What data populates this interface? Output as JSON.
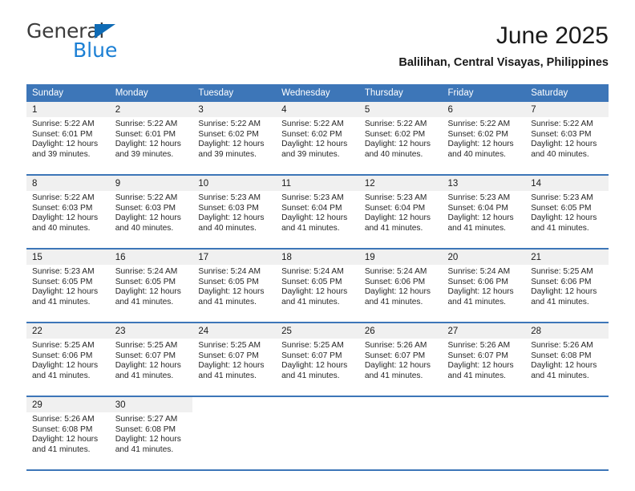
{
  "brand": {
    "name_dark": "General",
    "name_blue": "Blue",
    "triangle_color": "#0f6bb5",
    "blue_color": "#1b7fd4"
  },
  "header": {
    "title": "June 2025",
    "subtitle": "Balilihan, Central Visayas, Philippines"
  },
  "theme": {
    "header_blue": "#3d76b8",
    "daynum_band": "#f0f0f0",
    "text": "#1a1a1a"
  },
  "weekdays": [
    "Sunday",
    "Monday",
    "Tuesday",
    "Wednesday",
    "Thursday",
    "Friday",
    "Saturday"
  ],
  "labels": {
    "sunrise_prefix": "Sunrise: ",
    "sunset_prefix": "Sunset: ",
    "daylight_prefix": "Daylight: "
  },
  "weeks": [
    [
      {
        "day": "1",
        "sunrise": "Sunrise: 5:22 AM",
        "sunset": "Sunset: 6:01 PM",
        "daylight": "Daylight: 12 hours and 39 minutes."
      },
      {
        "day": "2",
        "sunrise": "Sunrise: 5:22 AM",
        "sunset": "Sunset: 6:01 PM",
        "daylight": "Daylight: 12 hours and 39 minutes."
      },
      {
        "day": "3",
        "sunrise": "Sunrise: 5:22 AM",
        "sunset": "Sunset: 6:02 PM",
        "daylight": "Daylight: 12 hours and 39 minutes."
      },
      {
        "day": "4",
        "sunrise": "Sunrise: 5:22 AM",
        "sunset": "Sunset: 6:02 PM",
        "daylight": "Daylight: 12 hours and 39 minutes."
      },
      {
        "day": "5",
        "sunrise": "Sunrise: 5:22 AM",
        "sunset": "Sunset: 6:02 PM",
        "daylight": "Daylight: 12 hours and 40 minutes."
      },
      {
        "day": "6",
        "sunrise": "Sunrise: 5:22 AM",
        "sunset": "Sunset: 6:02 PM",
        "daylight": "Daylight: 12 hours and 40 minutes."
      },
      {
        "day": "7",
        "sunrise": "Sunrise: 5:22 AM",
        "sunset": "Sunset: 6:03 PM",
        "daylight": "Daylight: 12 hours and 40 minutes."
      }
    ],
    [
      {
        "day": "8",
        "sunrise": "Sunrise: 5:22 AM",
        "sunset": "Sunset: 6:03 PM",
        "daylight": "Daylight: 12 hours and 40 minutes."
      },
      {
        "day": "9",
        "sunrise": "Sunrise: 5:22 AM",
        "sunset": "Sunset: 6:03 PM",
        "daylight": "Daylight: 12 hours and 40 minutes."
      },
      {
        "day": "10",
        "sunrise": "Sunrise: 5:23 AM",
        "sunset": "Sunset: 6:03 PM",
        "daylight": "Daylight: 12 hours and 40 minutes."
      },
      {
        "day": "11",
        "sunrise": "Sunrise: 5:23 AM",
        "sunset": "Sunset: 6:04 PM",
        "daylight": "Daylight: 12 hours and 41 minutes."
      },
      {
        "day": "12",
        "sunrise": "Sunrise: 5:23 AM",
        "sunset": "Sunset: 6:04 PM",
        "daylight": "Daylight: 12 hours and 41 minutes."
      },
      {
        "day": "13",
        "sunrise": "Sunrise: 5:23 AM",
        "sunset": "Sunset: 6:04 PM",
        "daylight": "Daylight: 12 hours and 41 minutes."
      },
      {
        "day": "14",
        "sunrise": "Sunrise: 5:23 AM",
        "sunset": "Sunset: 6:05 PM",
        "daylight": "Daylight: 12 hours and 41 minutes."
      }
    ],
    [
      {
        "day": "15",
        "sunrise": "Sunrise: 5:23 AM",
        "sunset": "Sunset: 6:05 PM",
        "daylight": "Daylight: 12 hours and 41 minutes."
      },
      {
        "day": "16",
        "sunrise": "Sunrise: 5:24 AM",
        "sunset": "Sunset: 6:05 PM",
        "daylight": "Daylight: 12 hours and 41 minutes."
      },
      {
        "day": "17",
        "sunrise": "Sunrise: 5:24 AM",
        "sunset": "Sunset: 6:05 PM",
        "daylight": "Daylight: 12 hours and 41 minutes."
      },
      {
        "day": "18",
        "sunrise": "Sunrise: 5:24 AM",
        "sunset": "Sunset: 6:05 PM",
        "daylight": "Daylight: 12 hours and 41 minutes."
      },
      {
        "day": "19",
        "sunrise": "Sunrise: 5:24 AM",
        "sunset": "Sunset: 6:06 PM",
        "daylight": "Daylight: 12 hours and 41 minutes."
      },
      {
        "day": "20",
        "sunrise": "Sunrise: 5:24 AM",
        "sunset": "Sunset: 6:06 PM",
        "daylight": "Daylight: 12 hours and 41 minutes."
      },
      {
        "day": "21",
        "sunrise": "Sunrise: 5:25 AM",
        "sunset": "Sunset: 6:06 PM",
        "daylight": "Daylight: 12 hours and 41 minutes."
      }
    ],
    [
      {
        "day": "22",
        "sunrise": "Sunrise: 5:25 AM",
        "sunset": "Sunset: 6:06 PM",
        "daylight": "Daylight: 12 hours and 41 minutes."
      },
      {
        "day": "23",
        "sunrise": "Sunrise: 5:25 AM",
        "sunset": "Sunset: 6:07 PM",
        "daylight": "Daylight: 12 hours and 41 minutes."
      },
      {
        "day": "24",
        "sunrise": "Sunrise: 5:25 AM",
        "sunset": "Sunset: 6:07 PM",
        "daylight": "Daylight: 12 hours and 41 minutes."
      },
      {
        "day": "25",
        "sunrise": "Sunrise: 5:25 AM",
        "sunset": "Sunset: 6:07 PM",
        "daylight": "Daylight: 12 hours and 41 minutes."
      },
      {
        "day": "26",
        "sunrise": "Sunrise: 5:26 AM",
        "sunset": "Sunset: 6:07 PM",
        "daylight": "Daylight: 12 hours and 41 minutes."
      },
      {
        "day": "27",
        "sunrise": "Sunrise: 5:26 AM",
        "sunset": "Sunset: 6:07 PM",
        "daylight": "Daylight: 12 hours and 41 minutes."
      },
      {
        "day": "28",
        "sunrise": "Sunrise: 5:26 AM",
        "sunset": "Sunset: 6:08 PM",
        "daylight": "Daylight: 12 hours and 41 minutes."
      }
    ],
    [
      {
        "day": "29",
        "sunrise": "Sunrise: 5:26 AM",
        "sunset": "Sunset: 6:08 PM",
        "daylight": "Daylight: 12 hours and 41 minutes."
      },
      {
        "day": "30",
        "sunrise": "Sunrise: 5:27 AM",
        "sunset": "Sunset: 6:08 PM",
        "daylight": "Daylight: 12 hours and 41 minutes."
      },
      {
        "day": "",
        "sunrise": "",
        "sunset": "",
        "daylight": ""
      },
      {
        "day": "",
        "sunrise": "",
        "sunset": "",
        "daylight": ""
      },
      {
        "day": "",
        "sunrise": "",
        "sunset": "",
        "daylight": ""
      },
      {
        "day": "",
        "sunrise": "",
        "sunset": "",
        "daylight": ""
      },
      {
        "day": "",
        "sunrise": "",
        "sunset": "",
        "daylight": ""
      }
    ]
  ]
}
